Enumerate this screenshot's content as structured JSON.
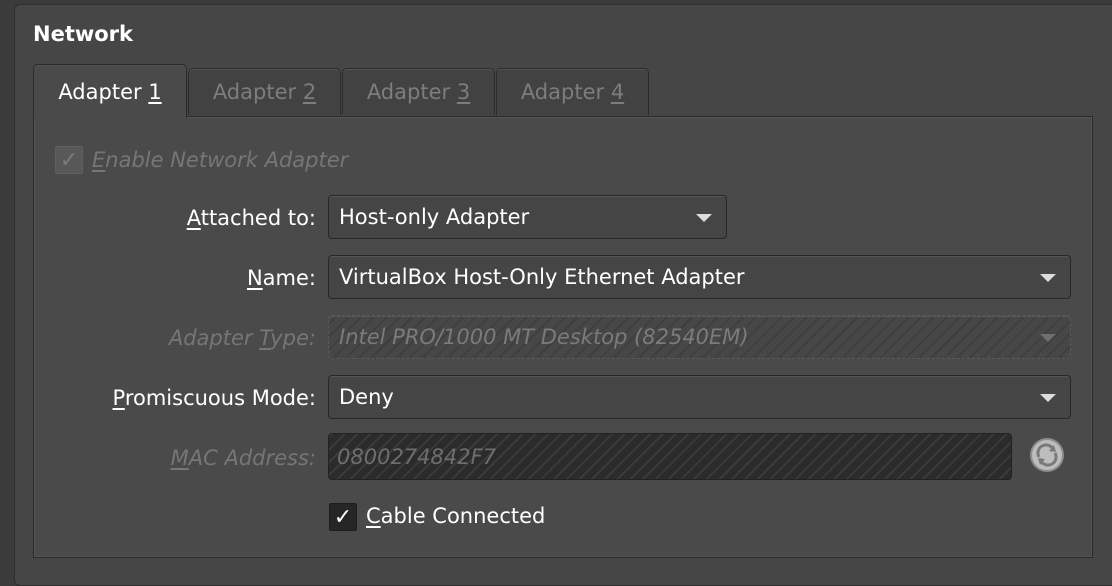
{
  "section": {
    "title": "Network"
  },
  "tabs": [
    {
      "label_pre": "Adapter ",
      "label_key": "1"
    },
    {
      "label_pre": "Adapter ",
      "label_key": "2"
    },
    {
      "label_pre": "Adapter ",
      "label_key": "3"
    },
    {
      "label_pre": "Adapter ",
      "label_key": "4"
    }
  ],
  "enable_adapter": {
    "key": "E",
    "rest": "nable Network Adapter",
    "checked": true
  },
  "attached_to": {
    "key": "A",
    "rest": "ttached to:",
    "value": "Host-only Adapter"
  },
  "name": {
    "key": "N",
    "rest": "ame:",
    "value": "VirtualBox Host-Only Ethernet Adapter"
  },
  "adapter_type": {
    "pre": "Adapter ",
    "key": "T",
    "rest": "ype:",
    "value": "Intel PRO/1000 MT Desktop (82540EM)"
  },
  "promiscuous": {
    "key": "P",
    "rest": "romiscuous Mode:",
    "value": "Deny"
  },
  "mac": {
    "key": "M",
    "rest": "AC Address:",
    "value": "0800274842F7",
    "refresh_icon": "refresh-icon"
  },
  "cable": {
    "key": "C",
    "rest": "able Connected",
    "checked": true
  }
}
